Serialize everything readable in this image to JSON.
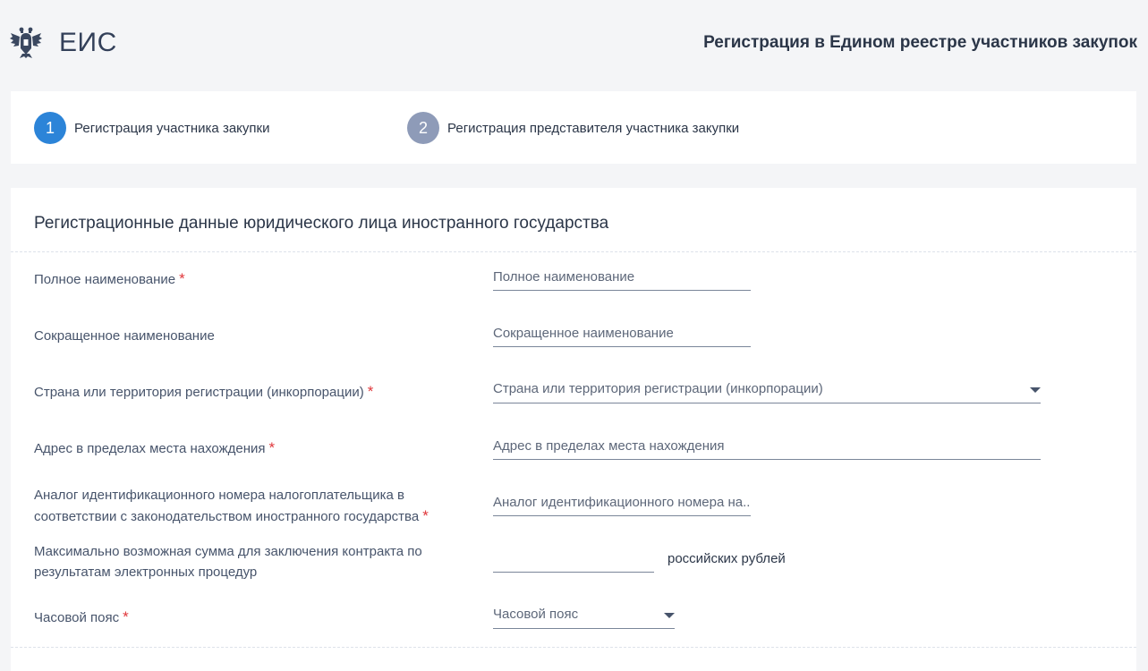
{
  "header": {
    "brand": "ЕИС",
    "page_heading": "Регистрация в Едином реестре участников закупок"
  },
  "steps": [
    {
      "number": "1",
      "label": "Регистрация участника закупки",
      "color": "#2c84d8"
    },
    {
      "number": "2",
      "label": "Регистрация представителя участника закупки",
      "color": "#8e9bb8"
    }
  ],
  "form": {
    "title": "Регистрационные данные юридического лица иностранного государства",
    "required_mark": "*",
    "fields": {
      "full_name": {
        "label": "Полное наименование",
        "placeholder": "Полное наименование"
      },
      "short_name": {
        "label": "Сокращенное наименование",
        "placeholder": "Сокращенное наименование"
      },
      "country": {
        "label": "Страна или территория регистрации (инкорпорации)",
        "placeholder": "Страна или территория регистрации (инкорпорации)"
      },
      "address": {
        "label": "Адрес в пределах места нахождения",
        "placeholder": "Адрес в пределах места нахождения"
      },
      "tax_id": {
        "label_line1": "Аналог идентификационного номера налогоплательщика в",
        "label_line2": "соответствии с законодательством иностранного государства",
        "placeholder": "Аналог идентификационного номера на..."
      },
      "max_sum": {
        "label_line1": "Максимально возможная сумма для заключения контракта по",
        "label_line2": "результатам электронных процедур",
        "value": "",
        "suffix": "российских рублей"
      },
      "timezone": {
        "label": "Часовой пояс",
        "placeholder": "Часовой пояс"
      }
    }
  },
  "colors": {
    "accent": "#2c84d8",
    "required": "#e0373b",
    "background": "#f4f5f7"
  }
}
